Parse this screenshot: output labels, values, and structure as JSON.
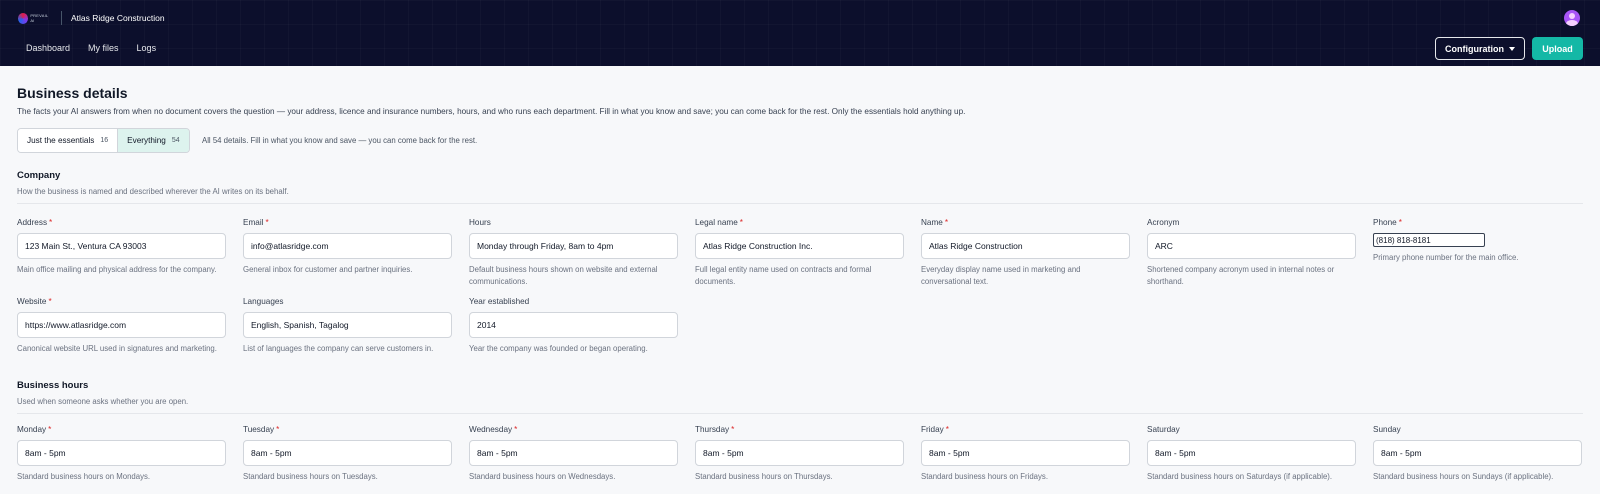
{
  "header": {
    "logo_text": "PREVAIL AI",
    "company": "Atlas Ridge Construction",
    "nav": [
      "Dashboard",
      "My files",
      "Logs"
    ],
    "config_label": "Configuration",
    "upload_label": "Upload"
  },
  "page": {
    "title": "Business details",
    "description": "The facts your AI answers from when no document covers the question — your address, licence and insurance numbers, hours, and who runs each department. Fill in what you know and save; you can come back for the rest. Only the essentials hold anything up.",
    "toggle": [
      {
        "label": "Just the essentials",
        "count": "16"
      },
      {
        "label": "Everything",
        "count": "54"
      }
    ],
    "toggle_note": "All 54 details. Fill in what you know and save — you can come back for the rest."
  },
  "company": {
    "title": "Company",
    "subtitle": "How the business is named and described wherever the AI writes on its behalf.",
    "fields": [
      {
        "label": "Address",
        "required": "*",
        "value": "123 Main St., Ventura CA 93003",
        "help": "Main office mailing and physical address for the company."
      },
      {
        "label": "Email",
        "required": "*",
        "value": "info@atlasridge.com",
        "help": "General inbox for customer and partner inquiries."
      },
      {
        "label": "Hours",
        "required": "",
        "value": "Monday through Friday, 8am to 4pm",
        "help": "Default business hours shown on website and external communications."
      },
      {
        "label": "Legal name",
        "required": "*",
        "value": "Atlas Ridge Construction Inc.",
        "help": "Full legal entity name used on contracts and formal documents."
      },
      {
        "label": "Name",
        "required": "*",
        "value": "Atlas Ridge Construction",
        "help": "Everyday display name used in marketing and conversational text."
      },
      {
        "label": "Acronym",
        "required": "",
        "value": "ARC",
        "help": "Shortened company acronym used in internal notes or shorthand."
      },
      {
        "label": "Phone",
        "required": "*",
        "value": "(818) 818-8181",
        "help": "Primary phone number for the main office."
      },
      {
        "label": "Website",
        "required": "*",
        "value": "https://www.atlasridge.com",
        "help": "Canonical website URL used in signatures and marketing."
      },
      {
        "label": "Languages",
        "required": "",
        "value": "English, Spanish, Tagalog",
        "help": "List of languages the company can serve customers in."
      },
      {
        "label": "Year established",
        "required": "",
        "value": "2014",
        "help": "Year the company was founded or began operating."
      }
    ]
  },
  "hours": {
    "title": "Business hours",
    "subtitle": "Used when someone asks whether you are open.",
    "fields": [
      {
        "label": "Monday",
        "required": "*",
        "value": "8am - 5pm",
        "help": "Standard business hours on Mondays."
      },
      {
        "label": "Tuesday",
        "required": "*",
        "value": "8am - 5pm",
        "help": "Standard business hours on Tuesdays."
      },
      {
        "label": "Wednesday",
        "required": "*",
        "value": "8am - 5pm",
        "help": "Standard business hours on Wednesdays."
      },
      {
        "label": "Thursday",
        "required": "*",
        "value": "8am - 5pm",
        "help": "Standard business hours on Thursdays."
      },
      {
        "label": "Friday",
        "required": "*",
        "value": "8am - 5pm",
        "help": "Standard business hours on Fridays."
      },
      {
        "label": "Saturday",
        "required": "",
        "value": "8am - 5pm",
        "help": "Standard business hours on Saturdays (if applicable)."
      },
      {
        "label": "Sunday",
        "required": "",
        "value": "8am - 5pm",
        "help": "Standard business hours on Sundays (if applicable)."
      }
    ]
  }
}
